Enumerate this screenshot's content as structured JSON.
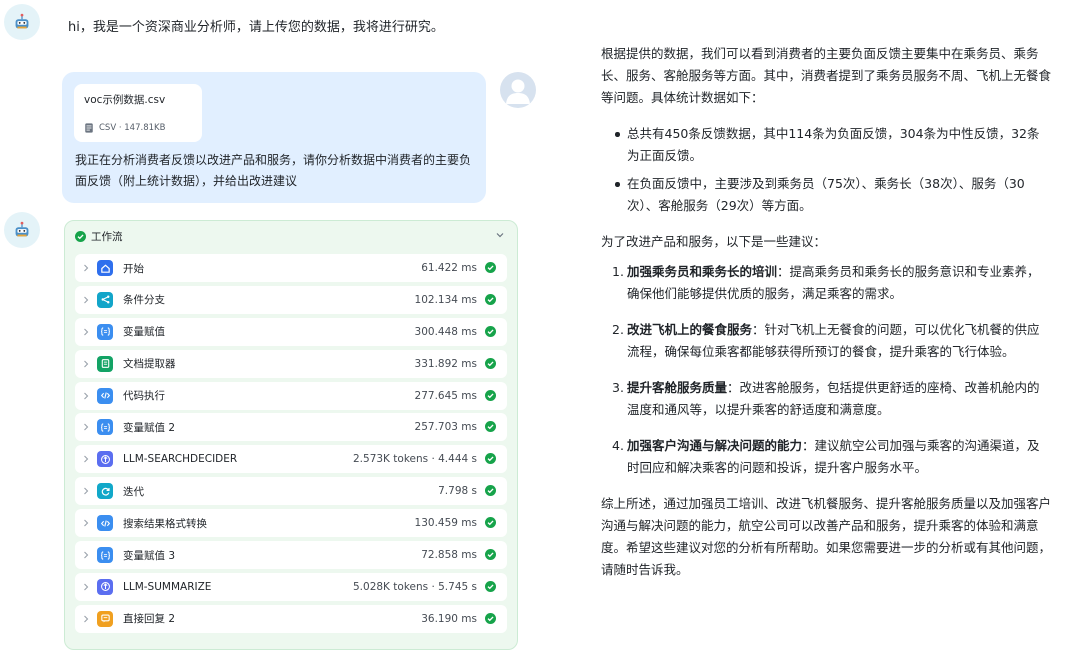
{
  "greeting": "hi，我是一个资深商业分析师，请上传您的数据，我将进行研究。",
  "user_message": {
    "file": {
      "name": "voc示例数据.csv",
      "type": "CSV",
      "size": "147.81KB"
    },
    "text": "我正在分析消费者反馈以改进产品和服务，请你分析数据中消费者的主要负面反馈（附上统计数据），并给出改进建议"
  },
  "workflow": {
    "title": "工作流",
    "steps": [
      {
        "label": "开始",
        "metric": "61.422 ms",
        "icon": "home-icon",
        "color": "#2f6fed"
      },
      {
        "label": "条件分支",
        "metric": "102.134 ms",
        "icon": "branch-icon",
        "color": "#12a5c9"
      },
      {
        "label": "变量赋值",
        "metric": "300.448 ms",
        "icon": "variable-icon",
        "color": "#3b8ef0"
      },
      {
        "label": "文档提取器",
        "metric": "331.892 ms",
        "icon": "doc-extract-icon",
        "color": "#13a365"
      },
      {
        "label": "代码执行",
        "metric": "277.645 ms",
        "icon": "code-icon",
        "color": "#3b8ef0"
      },
      {
        "label": "变量赋值 2",
        "metric": "257.703 ms",
        "icon": "variable-icon",
        "color": "#3b8ef0"
      },
      {
        "label": "LLM-SEARCHDECIDER",
        "metric": "2.573K tokens · 4.444 s",
        "icon": "llm-icon",
        "color": "#5b6ef0"
      },
      {
        "label": "迭代",
        "metric": "7.798 s",
        "icon": "iteration-icon",
        "color": "#11a8c9"
      },
      {
        "label": "搜索结果格式转换",
        "metric": "130.459 ms",
        "icon": "code-icon",
        "color": "#3b8ef0"
      },
      {
        "label": "变量赋值 3",
        "metric": "72.858 ms",
        "icon": "variable-icon",
        "color": "#3b8ef0"
      },
      {
        "label": "LLM-SUMMARIZE",
        "metric": "5.028K tokens · 5.745 s",
        "icon": "llm-icon",
        "color": "#5b6ef0"
      },
      {
        "label": "直接回复 2",
        "metric": "36.190 ms",
        "icon": "reply-icon",
        "color": "#f0a020"
      }
    ]
  },
  "answer": {
    "intro": "根据提供的数据，我们可以看到消费者的主要负面反馈主要集中在乘务员、乘务长、服务、客舱服务等方面。其中，消费者提到了乘务员服务不周、飞机上无餐食等问题。具体统计数据如下：",
    "bullets": [
      "总共有450条反馈数据，其中114条为负面反馈，304条为中性反馈，32条为正面反馈。",
      "在负面反馈中，主要涉及到乘务员（75次）、乘务长（38次）、服务（30次）、客舱服务（29次）等方面。"
    ],
    "suggest_intro": "为了改进产品和服务，以下是一些建议：",
    "suggestions": [
      {
        "num": "1.",
        "title": "加强乘务员和乘务长的培训",
        "text": "：提高乘务员和乘务长的服务意识和专业素养，确保他们能够提供优质的服务，满足乘客的需求。"
      },
      {
        "num": "2.",
        "title": "改进飞机上的餐食服务",
        "text": "：针对飞机上无餐食的问题，可以优化飞机餐的供应流程，确保每位乘客都能够获得所预订的餐食，提升乘客的飞行体验。"
      },
      {
        "num": "3.",
        "title": "提升客舱服务质量",
        "text": "：改进客舱服务，包括提供更舒适的座椅、改善机舱内的温度和通风等，以提升乘客的舒适度和满意度。"
      },
      {
        "num": "4.",
        "title": "加强客户沟通与解决问题的能力",
        "text": "：建议航空公司加强与乘客的沟通渠道，及时回应和解决乘客的问题和投诉，提升客户服务水平。"
      }
    ],
    "conclusion": "综上所述，通过加强员工培训、改进飞机餐服务、提升客舱服务质量以及加强客户沟通与解决问题的能力，航空公司可以改善产品和服务，提升乘客的体验和满意度。希望这些建议对您的分析有所帮助。如果您需要进一步的分析或有其他问题，请随时告诉我。"
  }
}
